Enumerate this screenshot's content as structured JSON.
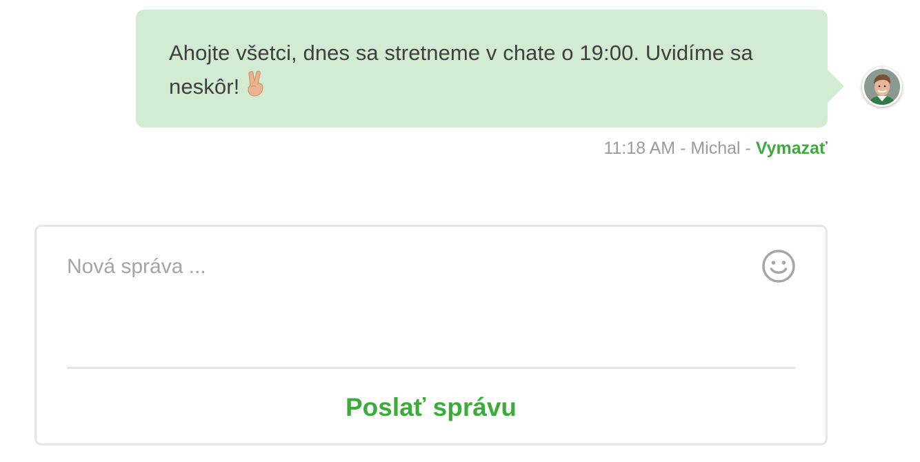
{
  "message": {
    "text": "Ahojte všetci, dnes sa stretneme v chate o 19:00. Uvidíme sa neskôr!",
    "emoji_icon": "victory-hand-icon",
    "bubble_color": "#d2ebd3",
    "time": "11:18 AM",
    "separator": " - ",
    "author": "Michal",
    "delete_label": "Vymazať",
    "avatar_icon": "user-avatar"
  },
  "composer": {
    "placeholder": "Nová správa ...",
    "emoji_icon": "smiley-icon",
    "send_label": "Poslať správu",
    "accent_color": "#3cab3c"
  }
}
